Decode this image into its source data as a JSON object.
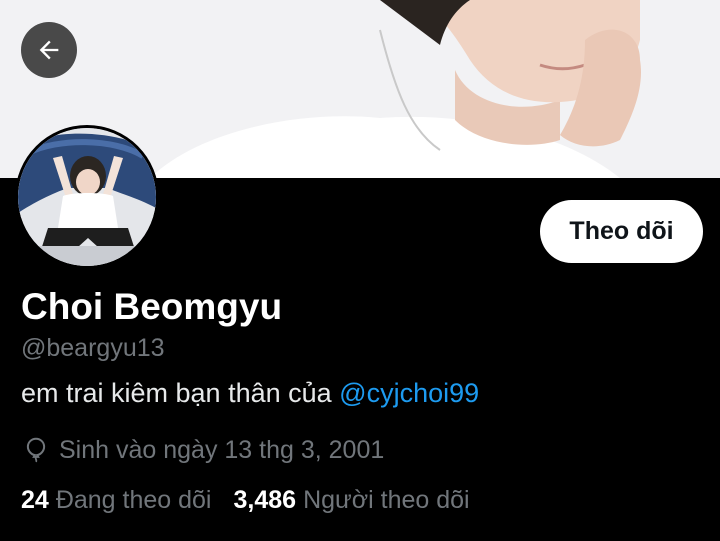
{
  "header": {
    "back_icon": "arrow-left-icon",
    "banner_image": "banner-photo"
  },
  "profile": {
    "avatar_image": "avatar-photo",
    "follow_label": "Theo dõi",
    "name": "Choi Beomgyu",
    "handle": "@beargyu13",
    "bio_text": "em trai kiêm bạn thân của ",
    "bio_mention": "@cyjchoi99",
    "birth_icon": "balloon-icon",
    "birth_text": "Sinh vào ngày 13 thg 3, 2001",
    "following_count": "24",
    "following_label": "Đang theo dõi",
    "followers_count": "3,486",
    "followers_label": "Người theo dõi"
  },
  "colors": {
    "background": "#000000",
    "accent_link": "#1d9bf0",
    "secondary_text": "#71767b",
    "follow_button_bg": "#ffffff"
  }
}
